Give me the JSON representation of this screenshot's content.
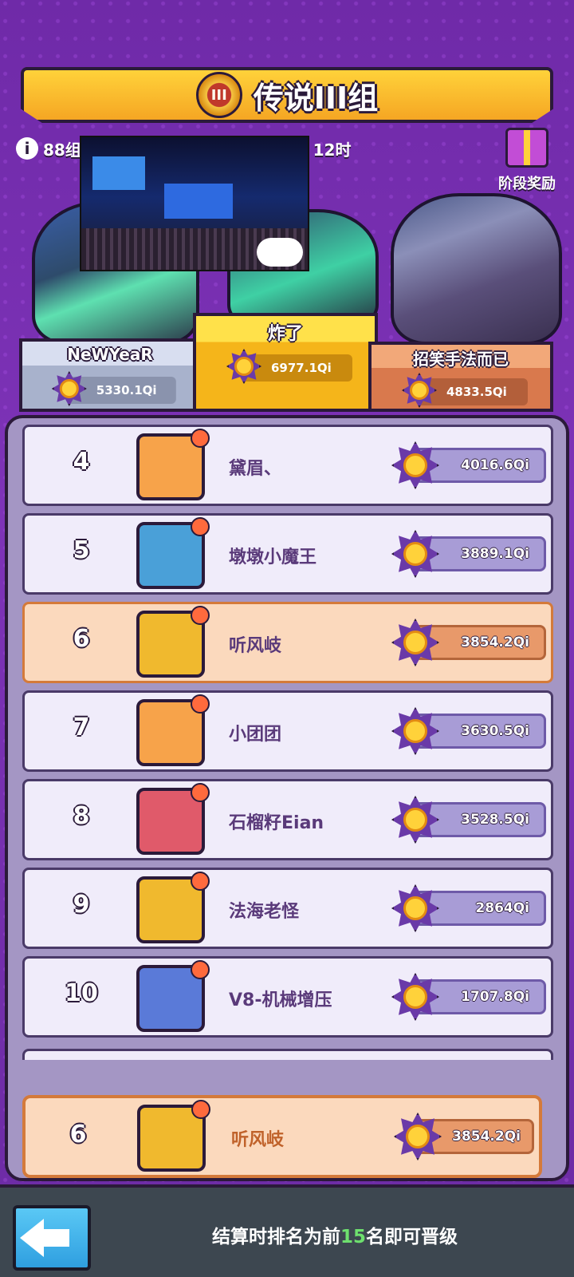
{
  "header": {
    "title": "传说III组",
    "badge_label": "III",
    "participant_count": "88",
    "participant_suffix": "组",
    "timer": "时:02天 12时",
    "reward_label": "阶段奖励"
  },
  "podium": [
    {
      "place": 2,
      "name": "NeWYeaR",
      "score": "5330.1Qi"
    },
    {
      "place": 1,
      "name": "炸了",
      "score": "6977.1Qi"
    },
    {
      "place": 3,
      "name": "招笑手法而已",
      "score": "4833.5Qi"
    }
  ],
  "rows": [
    {
      "rank": "4",
      "name": "黛眉、",
      "score": "4016.6Qi",
      "avatar_color": "#f7a34a",
      "me": false
    },
    {
      "rank": "5",
      "name": "墩墩小魔王",
      "score": "3889.1Qi",
      "avatar_color": "#4aa0d8",
      "me": false
    },
    {
      "rank": "6",
      "name": "听风岐",
      "score": "3854.2Qi",
      "avatar_color": "#f0b92e",
      "me": true
    },
    {
      "rank": "7",
      "name": "小团团",
      "score": "3630.5Qi",
      "avatar_color": "#f7a34a",
      "me": false
    },
    {
      "rank": "8",
      "name": "石榴籽Eian",
      "score": "3528.5Qi",
      "avatar_color": "#e05a6a",
      "me": false
    },
    {
      "rank": "9",
      "name": "法海老怪",
      "score": "2864Qi",
      "avatar_color": "#f0b92e",
      "me": false
    },
    {
      "rank": "10",
      "name": "V8-机械增压",
      "score": "1707.8Qi",
      "avatar_color": "#5a7ad8",
      "me": false
    }
  ],
  "pinned": {
    "rank": "6",
    "name": "听风岐",
    "score": "3854.2Qi"
  },
  "bottom": {
    "hint_prefix": "结算时排名为前",
    "hint_number": "15",
    "hint_suffix": "名即可晋级"
  },
  "colors": {
    "background": "#7a2fb0",
    "gold": "#ffd23a",
    "highlight_row": "#fbd9bd",
    "promotion_number": "#6ee06e"
  }
}
